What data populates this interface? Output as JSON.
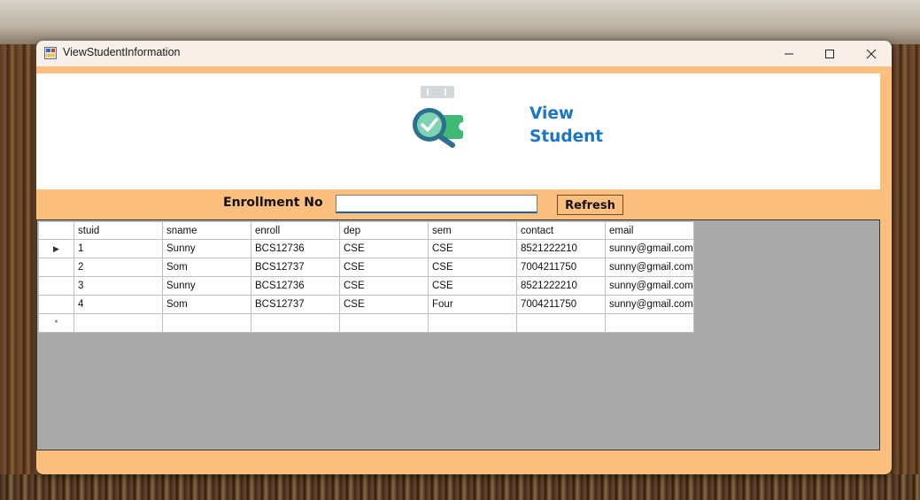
{
  "window": {
    "title": "ViewStudentInformation",
    "controls": {
      "minimize": "—",
      "maximize": "☐",
      "close": "✕"
    }
  },
  "header": {
    "title_line1": "View",
    "title_line2": "Student",
    "icon": "search-check-icon",
    "title_color": "#1976c5"
  },
  "search": {
    "label": "Enrollment No",
    "value": "",
    "refresh_label": "Refresh"
  },
  "colors": {
    "form_bg": "#fdbf7e",
    "selected_cell": "#0a78d7",
    "grid_bg": "#aaaaaa"
  },
  "table": {
    "columns": [
      "stuid",
      "sname",
      "enroll",
      "dep",
      "sem",
      "contact",
      "email"
    ],
    "rows": [
      [
        "1",
        "Sunny",
        "BCS12736",
        "CSE",
        "CSE",
        "8521222210",
        "sunny@gmail.com"
      ],
      [
        "2",
        "Som",
        "BCS12737",
        "CSE",
        "CSE",
        "7004211750",
        "sunny@gmail.com"
      ],
      [
        "3",
        "Sunny",
        "BCS12736",
        "CSE",
        "CSE",
        "8521222210",
        "sunny@gmail.com"
      ],
      [
        "4",
        "Som",
        "BCS12737",
        "CSE",
        "Four",
        "7004211750",
        "sunny@gmail.com"
      ]
    ],
    "current_row_marker": "▶",
    "new_row_marker": "*"
  }
}
